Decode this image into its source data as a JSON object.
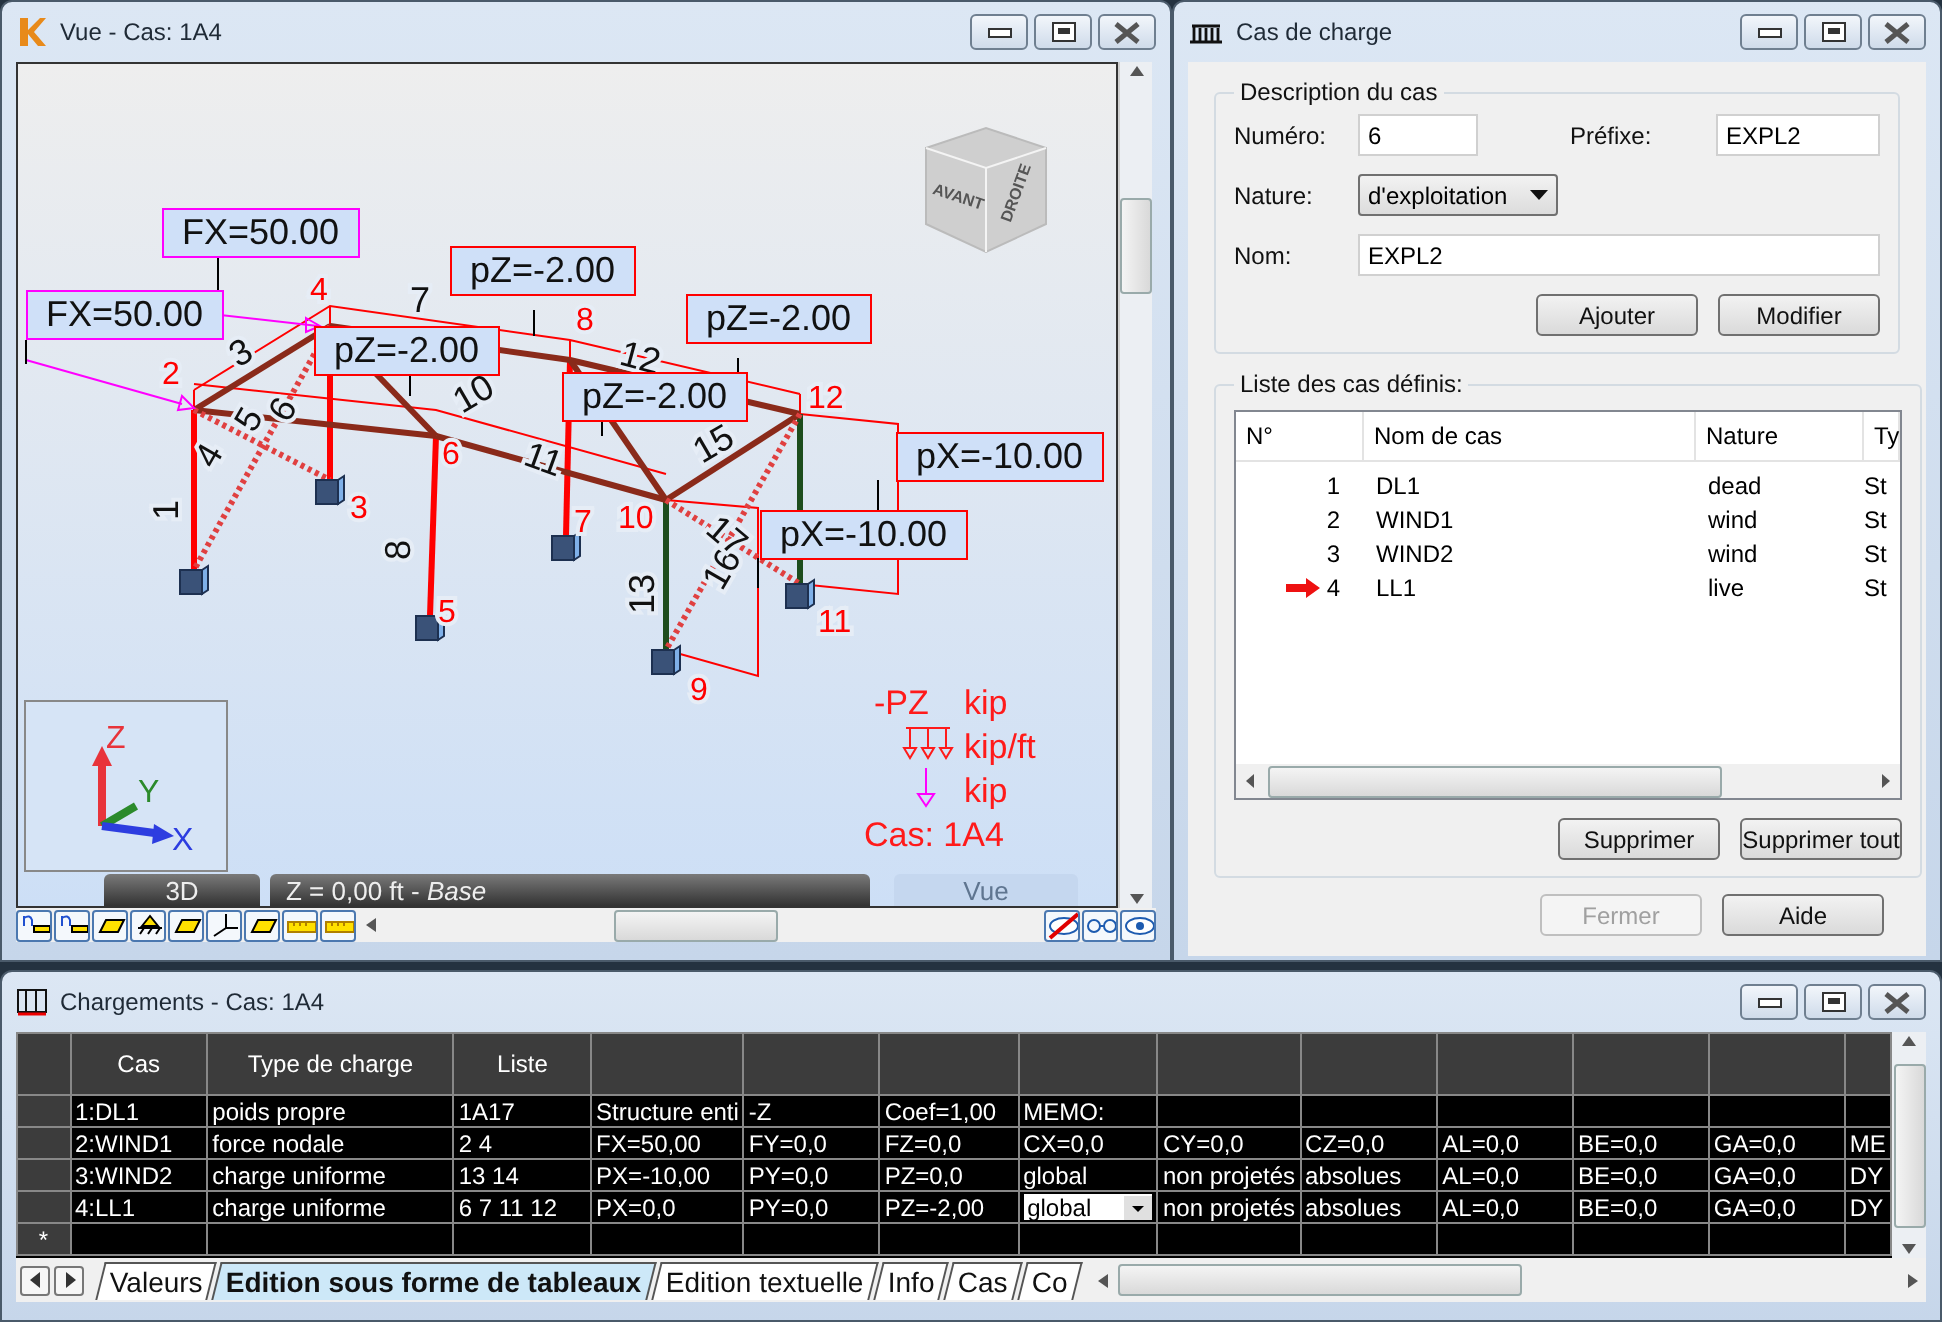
{
  "viewport_window": {
    "title": "Vue - Cas: 1A4",
    "load_labels": [
      {
        "text": "FX=50.00",
        "color": "#ff00ff"
      },
      {
        "text": "FX=50.00",
        "color": "#ff00ff"
      },
      {
        "text": "pZ=-2.00",
        "color": "#ff0000"
      },
      {
        "text": "pZ=-2.00",
        "color": "#ff0000"
      },
      {
        "text": "pZ=-2.00",
        "color": "#ff0000"
      },
      {
        "text": "pZ=-2.00",
        "color": "#ff0000"
      },
      {
        "text": "pX=-10.00",
        "color": "#ff0000"
      },
      {
        "text": "pX=-10.00",
        "color": "#ff0000"
      }
    ],
    "node_numbers": [
      "4",
      "2",
      "3",
      "6",
      "8",
      "7",
      "5",
      "10",
      "12",
      "9",
      "11"
    ],
    "member_numbers": [
      "3",
      "7",
      "4",
      "5",
      "6",
      "10",
      "11",
      "12",
      "15",
      "1",
      "8",
      "13",
      "16",
      "17"
    ],
    "view_cube": {
      "faces": [
        "AVANT",
        "DROITE"
      ]
    },
    "axes": [
      "Z",
      "Y",
      "X"
    ],
    "legend": {
      "force_symbol": "-PZ",
      "units": [
        "kip",
        "kip/ft",
        "kip"
      ],
      "case": "Cas: 1A4"
    },
    "view_bar": {
      "mode": "3D",
      "plane": "Z = 0,00 ft - *Base*",
      "view": "Vue"
    }
  },
  "load_case_dialog": {
    "title": "Cas de charge",
    "description_group": {
      "title": "Description du cas",
      "number_label": "Numéro:",
      "number": "6",
      "prefix_label": "Préfixe:",
      "prefix": "EXPL2",
      "nature_label": "Nature:",
      "nature": "d'exploitation",
      "name_label": "Nom:",
      "name": "EXPL2",
      "buttons": [
        {
          "label": "Ajouter",
          "disabled": false
        },
        {
          "label": "Modifier",
          "disabled": false
        }
      ]
    },
    "list_group": {
      "title": "Liste des cas définis:",
      "columns": [
        "N°",
        "Nom de cas",
        "Nature",
        "Ty"
      ],
      "rows": [
        {
          "number": "1",
          "name": "DL1",
          "nature": "dead",
          "type": "St",
          "current": false
        },
        {
          "number": "2",
          "name": "WIND1",
          "nature": "wind",
          "type": "St",
          "current": false
        },
        {
          "number": "3",
          "name": "WIND2",
          "nature": "wind",
          "type": "St",
          "current": false
        },
        {
          "number": "4",
          "name": "LL1",
          "nature": "live",
          "type": "St",
          "current": true
        }
      ],
      "buttons": [
        {
          "label": "Supprimer",
          "disabled": false
        },
        {
          "label": "Supprimer tout",
          "disabled": false
        }
      ]
    },
    "buttons": [
      {
        "label": "Fermer",
        "disabled": true
      },
      {
        "label": "Aide",
        "disabled": false
      }
    ]
  },
  "loads_window": {
    "title": "Chargements - Cas: 1A4",
    "table": {
      "columns": [
        "Cas",
        "Type de charge",
        "Liste"
      ],
      "rows": [
        {
          "cells": [
            "1:DL1",
            "poids propre",
            "1A17",
            "Structure enti",
            "-Z",
            "Coef=1,00",
            "MEMO:"
          ]
        },
        {
          "cells": [
            "2:WIND1",
            "force nodale",
            "2 4",
            "FX=50,00",
            "FY=0,0",
            "FZ=0,0",
            "CX=0,0",
            "CY=0,0",
            "CZ=0,0",
            "AL=0,0",
            "BE=0,0",
            "GA=0,0",
            "ME"
          ]
        },
        {
          "cells": [
            "3:WIND2",
            "charge uniforme",
            "13 14",
            "PX=-10,00",
            "PY=0,0",
            "PZ=0,0",
            "global",
            "non projetés",
            "absolues",
            "AL=0,0",
            "BE=0,0",
            "GA=0,0",
            "DY"
          ]
        },
        {
          "cells": [
            "4:LL1",
            "charge uniforme",
            "6 7 11 12",
            "PX=0,0",
            "PY=0,0",
            "PZ=-2,00",
            {
              "kind": "dropdown",
              "value": "global"
            },
            "non projetés",
            "absolues",
            "AL=0,0",
            "BE=0,0",
            "GA=0,0",
            "DY"
          ]
        }
      ],
      "new_row_marker": "*"
    },
    "tabs": [
      {
        "label": "Valeurs",
        "selected": false
      },
      {
        "label": "Edition sous forme de tableaux",
        "selected": true
      },
      {
        "label": "Edition textuelle",
        "selected": false
      },
      {
        "label": "Info",
        "selected": false
      },
      {
        "label": "Cas",
        "selected": false
      },
      {
        "label": "Co",
        "selected": false
      }
    ]
  }
}
